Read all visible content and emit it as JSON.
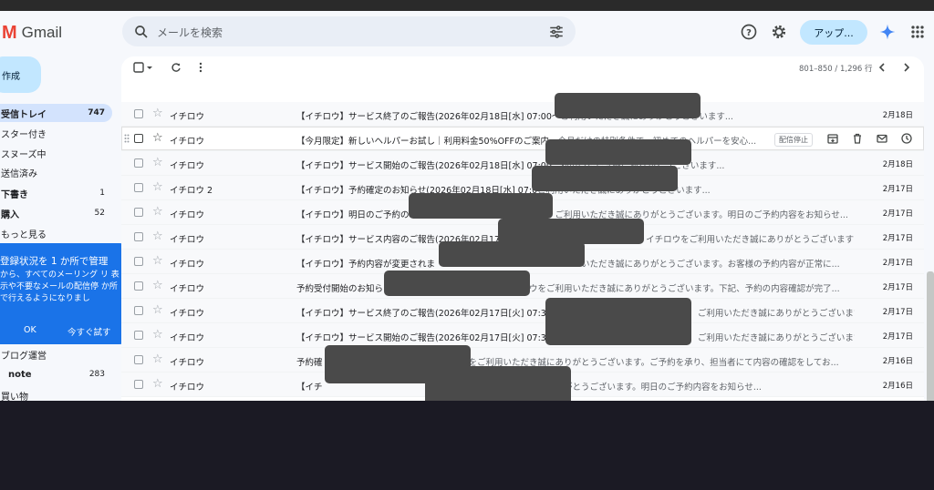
{
  "app": {
    "name": "Gmail"
  },
  "search": {
    "placeholder": "メールを検索"
  },
  "header": {
    "upgrade_label": "アップ..."
  },
  "sidebar": {
    "compose_label": "作成",
    "items": [
      {
        "label": "受信トレイ",
        "count": "747"
      },
      {
        "label": "スター付き",
        "count": ""
      },
      {
        "label": "スヌーズ中",
        "count": ""
      },
      {
        "label": "送信済み",
        "count": ""
      },
      {
        "label": "下書き",
        "count": "1"
      },
      {
        "label": "購入",
        "count": "52"
      },
      {
        "label": "もっと見る",
        "count": ""
      }
    ],
    "labels": [
      {
        "label": "ブログ運営",
        "count": ""
      },
      {
        "label": "note",
        "count": "283"
      },
      {
        "label": "買い物",
        "count": ""
      }
    ]
  },
  "popup": {
    "title": "登録状況を 1 か所で管理",
    "body": "から、すべてのメーリング リ 表示や不要なメールの配信停 か所で行えるようになりまし",
    "ok_label": "OK",
    "try_label": "今すぐ試す"
  },
  "toolbar": {
    "range": "801–850 / 1,296 行"
  },
  "emails": [
    {
      "sender": "イチロウ",
      "subject": "【イチロウ】サービス終了のご報告(2026年02月18日[水] 07:00〜",
      "snippet": "ご利用いただき誠にありがとうございます...",
      "date": "2月18日"
    },
    {
      "sender": "イチロウ",
      "subject": "【今月限定】新しいヘルパーお試し｜利用料金50%OFFのご案内",
      "snippet": " - 今月だけの特別条件で、初めてのヘルパーを安心...",
      "date": "",
      "badge": "配信停止"
    },
    {
      "sender": "イチロウ",
      "subject": "【イチロウ】サービス開始のご報告(2026年02月18日[水] 07:00",
      "snippet": "ご利用いただき誠にありがとうございます...",
      "date": "2月18日"
    },
    {
      "sender": "イチロウ 2",
      "subject": "【イチロウ】予約確定のお知らせ(2026年02月18日[水] 07:0",
      "snippet": "ご利用いただき誠にありがとうございます...",
      "date": "2月17日"
    },
    {
      "sender": "イチロウ",
      "subject": "【イチロウ】明日のご予約の",
      "snippet": "ご利用いただき誠にありがとうございます。明日のご予約内容をお知らせ...",
      "date": "2月17日"
    },
    {
      "sender": "イチロウ",
      "subject": "【イチロウ】サービス内容のご報告(2026年02月17",
      "snippet": "イチロウをご利用いただき誠にありがとうございます...",
      "date": "2月17日"
    },
    {
      "sender": "イチロウ",
      "subject": "【イチロウ】予約内容が変更されま",
      "snippet": "いただき誠にありがとうございます。お客様の予約内容が正常に...",
      "date": "2月17日"
    },
    {
      "sender": "イチロウ",
      "subject": "予約受付開始のお知ら",
      "snippet": "ウをご利用いただき誠にありがとうございます。下記、予約の内容確認が完了...",
      "date": "2月17日"
    },
    {
      "sender": "イチロウ",
      "subject": "【イチロウ】サービス終了のご報告(2026年02月17日[火] 07:30",
      "snippet": "ご利用いただき誠にありがとうございます...",
      "date": "2月17日"
    },
    {
      "sender": "イチロウ",
      "subject": "【イチロウ】サービス開始のご報告(2026年02月17日[火] 07:30",
      "snippet": "ご利用いただき誠にありがとうございます...",
      "date": "2月17日"
    },
    {
      "sender": "イチロウ",
      "subject": "予約確",
      "snippet": "をご利用いただき誠にありがとうございます。ご予約を承り、担当者にて内容の確認をしてお...",
      "date": "2月16日"
    },
    {
      "sender": "イチロウ",
      "subject": "【イチ",
      "snippet": "ご利用いただき誠にありがとうございます。明日のご予約内容をお知らせ...",
      "date": "2月16日"
    }
  ],
  "colors": {
    "accent": "#1a73e8",
    "compose": "#c2e7ff",
    "active_nav": "#d3e3fd",
    "redaction": "#4a4a4a"
  }
}
